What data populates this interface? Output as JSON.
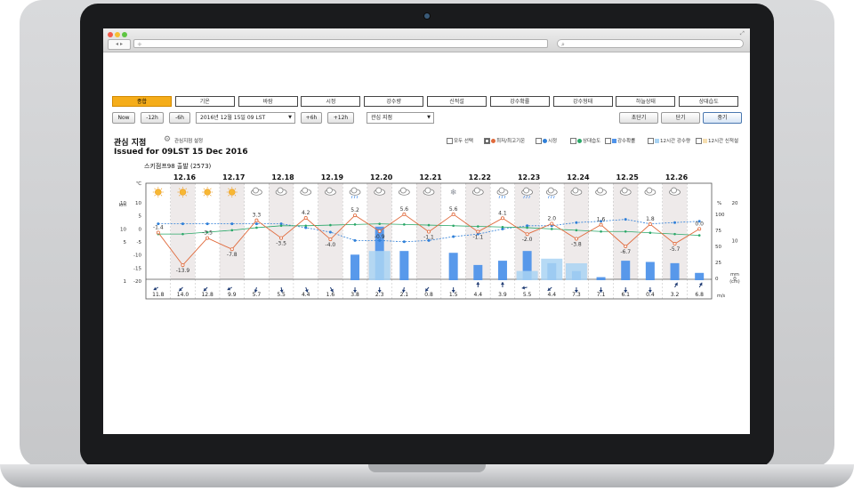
{
  "browser": {
    "url": "+",
    "search": ""
  },
  "tabs": [
    "종합",
    "기온",
    "바람",
    "시정",
    "강수량",
    "신적설",
    "강수확률",
    "강수형태",
    "하늘상태",
    "상대습도"
  ],
  "controls": {
    "now": "Now",
    "minus12": "-12h",
    "minus6": "-6h",
    "datetime": "2016년 12월 15일 09 LST",
    "plus6": "+6h",
    "plus12": "+12h",
    "site_select": "관심 지점",
    "view_short": "초단기",
    "view_mid": "단기",
    "view_long": "중기"
  },
  "header": {
    "title": "관심 지점",
    "setting": "관심지점 설정",
    "issued": "Issued for 09LST 15 Dec 2016",
    "location": "스키점프98 출발 (2573)"
  },
  "legend": [
    "모두 선택",
    "최저/최고기온",
    "시정",
    "상대습도",
    "강수확률",
    "12시간 강수량",
    "12시간 신적설"
  ],
  "colors": {
    "active_tab": "#f5ad1a",
    "temp_line": "#e06a3c",
    "visibility_line": "#2f7fd8",
    "humidity_line": "#2aa868",
    "precip_bar": "#4f93ea",
    "rain_amount_bar": "#a9d3f3"
  },
  "chart_data": {
    "type": "line",
    "dates": [
      "12.16",
      "12.17",
      "12.18",
      "12.19",
      "12.20",
      "12.21",
      "12.22",
      "12.23",
      "12.24",
      "12.25",
      "12.26"
    ],
    "left_axis_unit": "℃",
    "left_ticks": [
      "10",
      "5",
      "0",
      "-5",
      "-10",
      "-15",
      "-20"
    ],
    "left_km_ticks": [
      "10",
      "",
      "10",
      "5",
      "",
      "",
      "1"
    ],
    "left_km_unit": "km",
    "right_pct_unit": "%",
    "right_pct_ticks": [
      "100",
      "75",
      "50",
      "25",
      "0"
    ],
    "right_mm_unit": "mm (cm)",
    "right_mm_ticks": [
      "20",
      "",
      "10",
      "",
      "0"
    ],
    "wind_unit": "m/s",
    "sky_icons": [
      "sun",
      "sun",
      "sun",
      "sun",
      "cloud",
      "cloud",
      "cloud",
      "cloud",
      "rain",
      "cloud",
      "cloud",
      "cloud",
      "snow",
      "cloud",
      "rain",
      "rain",
      "rain",
      "cloud",
      "cloud",
      "cloud",
      "cloud",
      "cloud"
    ],
    "temperature": [
      -1.4,
      -13.9,
      -3.5,
      -7.8,
      3.3,
      -3.5,
      4.2,
      -4.0,
      5.2,
      -0.9,
      5.6,
      -1.1,
      5.6,
      -1.1,
      4.1,
      -2.0,
      2.0,
      -3.8,
      1.6,
      -6.7,
      1.8,
      -5.7,
      0.0
    ],
    "temperature_labels": [
      "-1.4",
      "-13.9",
      "-3.5",
      "-7.8",
      "3.3",
      "-3.5",
      "4.2",
      "-4.0",
      "5.2",
      "-0.9",
      "5.6",
      "-1.1",
      "5.6",
      "-1.1",
      "4.1",
      "-2.0",
      "2.0",
      "-3.8",
      "1.6",
      "-6.7",
      "1.8",
      "-5.7",
      "0.0"
    ],
    "visibility_pct": [
      88,
      88,
      88,
      88,
      88,
      88,
      82,
      75,
      62,
      62,
      60,
      62,
      68,
      72,
      80,
      85,
      85,
      90,
      92,
      95,
      88,
      90,
      92
    ],
    "humidity_pct": [
      72,
      72,
      75,
      78,
      82,
      85,
      85,
      86,
      87,
      88,
      87,
      86,
      85,
      84,
      83,
      82,
      80,
      78,
      76,
      76,
      74,
      72,
      70
    ],
    "precip_prob": [
      0,
      0,
      0,
      0,
      0,
      0,
      0,
      0,
      40,
      30,
      40,
      0,
      40,
      0,
      40,
      0,
      20,
      20,
      30,
      30,
      30,
      30,
      30
    ],
    "precip_prob_full": [
      0,
      0,
      0,
      0,
      0,
      0,
      0,
      0,
      42,
      88,
      48,
      0,
      45,
      25,
      32,
      48,
      28,
      15,
      5,
      32,
      30,
      28,
      12
    ],
    "rain_amount": [
      0,
      0,
      0,
      0,
      0,
      0,
      0,
      0,
      0,
      38,
      0,
      0,
      0,
      0,
      0,
      12,
      28,
      22,
      0,
      0,
      0,
      0,
      0
    ],
    "wind_speed": [
      "11.8",
      "14.0",
      "12.8",
      "9.9",
      "5.7",
      "5.5",
      "4.4",
      "1.6",
      "3.8",
      "2.3",
      "2.1",
      "0.8",
      "1.5",
      "4.4",
      "3.9",
      "5.5",
      "4.4",
      "7.3",
      "7.1",
      "6.1",
      "0.4",
      "3.2",
      "6.8"
    ],
    "wind_dir_deg": [
      150,
      135,
      135,
      150,
      105,
      80,
      70,
      60,
      90,
      90,
      100,
      130,
      90,
      270,
      270,
      170,
      140,
      90,
      90,
      90,
      90,
      300,
      300
    ]
  }
}
